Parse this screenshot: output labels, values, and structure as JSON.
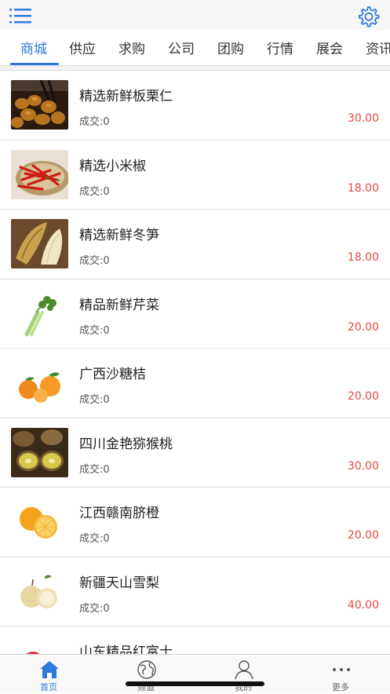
{
  "header": {
    "menu_icon": "menu-icon",
    "settings_icon": "gear-icon"
  },
  "tabs": [
    {
      "label": "商城",
      "active": true
    },
    {
      "label": "供应"
    },
    {
      "label": "求购"
    },
    {
      "label": "公司"
    },
    {
      "label": "团购"
    },
    {
      "label": "行情"
    },
    {
      "label": "展会"
    },
    {
      "label": "资讯"
    }
  ],
  "products": [
    {
      "title": "精选新鲜板栗仁",
      "deal": "成交:0",
      "price": "30.00",
      "image": "chestnut"
    },
    {
      "title": "精选小米椒",
      "deal": "成交:0",
      "price": "18.00",
      "image": "chili"
    },
    {
      "title": "精选新鲜冬笋",
      "deal": "成交:0",
      "price": "18.00",
      "image": "bamboo-shoot"
    },
    {
      "title": "精品新鲜芹菜",
      "deal": "成交:0",
      "price": "20.00",
      "image": "celery"
    },
    {
      "title": "广西沙糖桔",
      "deal": "成交:0",
      "price": "20.00",
      "image": "tangerine"
    },
    {
      "title": "四川金艳猕猴桃",
      "deal": "成交:0",
      "price": "30.00",
      "image": "kiwi"
    },
    {
      "title": "江西赣南脐橙",
      "deal": "成交:0",
      "price": "20.00",
      "image": "orange"
    },
    {
      "title": "新疆天山雪梨",
      "deal": "成交:0",
      "price": "40.00",
      "image": "pear"
    },
    {
      "title": "山东精品红富士",
      "deal": "",
      "price": "",
      "image": "apple"
    }
  ],
  "bottom_nav": [
    {
      "label": "首页",
      "icon": "home-icon",
      "active": true
    },
    {
      "label": "频道",
      "icon": "globe-icon"
    },
    {
      "label": "我的",
      "icon": "user-icon"
    },
    {
      "label": "更多",
      "icon": "more-icon"
    }
  ],
  "colors": {
    "accent": "#2f7bdc",
    "price": "#e24a43"
  }
}
